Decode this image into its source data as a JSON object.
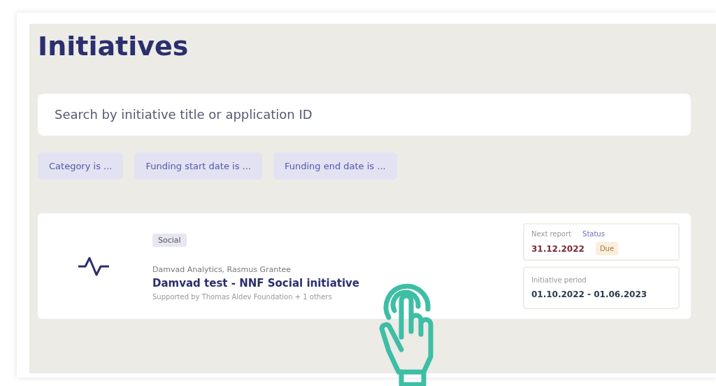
{
  "title": "Initiatives",
  "search": {
    "placeholder": "Search by initiative title or application ID"
  },
  "filters": [
    "Category is ...",
    "Funding start date is ...",
    "Funding end date is ..."
  ],
  "initiatives": [
    {
      "tag": "Social",
      "applicant": "Damvad Analytics, Rasmus Grantee",
      "name": "Damvad test - NNF Social initiative",
      "supported_by": "Supported by Thomas Aldev Foundation + 1 others",
      "next_report_label": "Next report",
      "status_label": "Status",
      "next_report_date": "31.12.2022",
      "status": "Due",
      "period_label": "Initiative period",
      "period": "01.10.2022 - 01.06.2023"
    }
  ]
}
